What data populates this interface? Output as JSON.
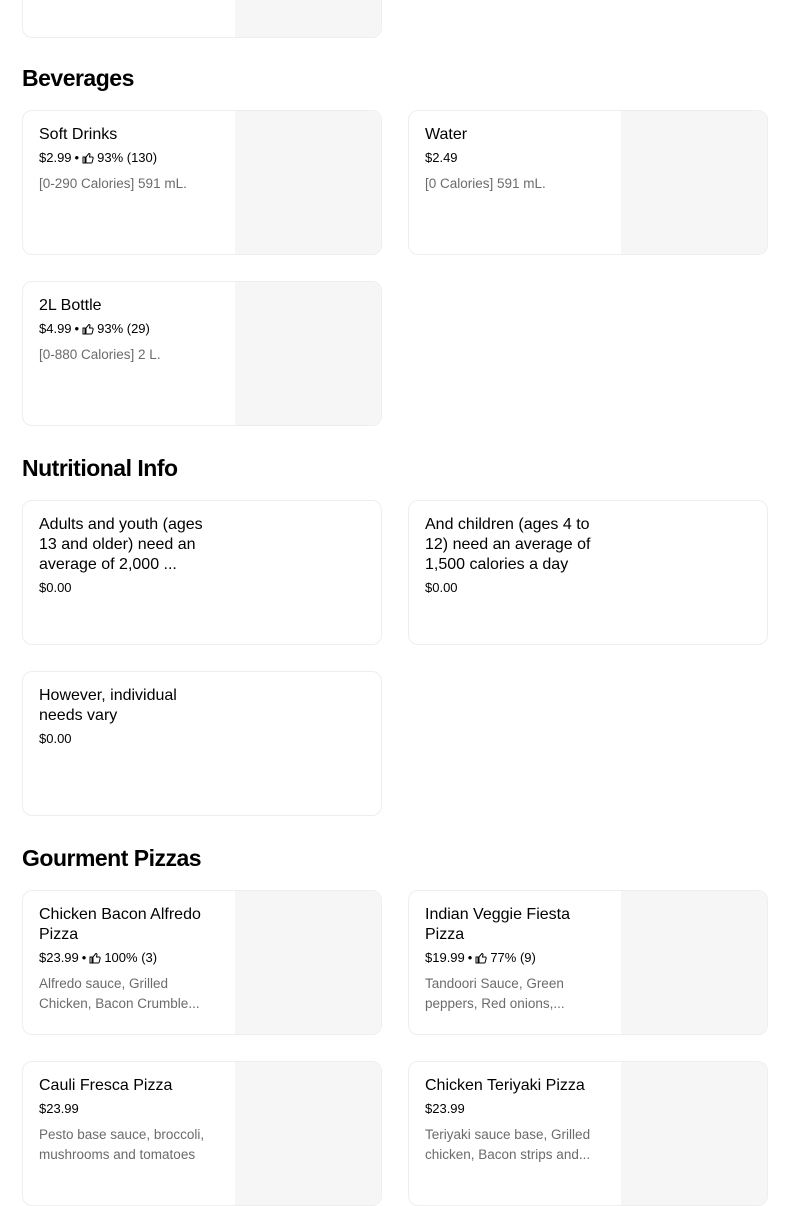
{
  "sections": {
    "beverages": {
      "title": "Beverages",
      "items": [
        {
          "name": "Soft Drinks",
          "price": "$2.99",
          "rating": "93% (130)",
          "description": "[0-290 Calories] 591 mL."
        },
        {
          "name": "Water",
          "price": "$2.49",
          "description": "[0 Calories] 591 mL."
        },
        {
          "name": "2L Bottle",
          "price": "$4.99",
          "rating": "93% (29)",
          "description": "[0-880 Calories] 2 L."
        }
      ]
    },
    "nutritional": {
      "title": "Nutritional Info",
      "items": [
        {
          "name": "Adults and youth (ages 13 and older) need an average of 2,000 ...",
          "price": "$0.00"
        },
        {
          "name": "And children (ages 4 to 12) need an average of 1,500 calories a day",
          "price": "$0.00"
        },
        {
          "name": "However, individual needs vary",
          "price": "$0.00"
        }
      ]
    },
    "gourmet": {
      "title": "Gourment Pizzas",
      "items": [
        {
          "name": "Chicken Bacon Alfredo Pizza",
          "price": "$23.99",
          "rating": "100% (3)",
          "description": "Alfredo sauce, Grilled Chicken, Bacon Crumble..."
        },
        {
          "name": "Indian Veggie Fiesta Pizza",
          "price": "$19.99",
          "rating": "77% (9)",
          "description": "Tandoori Sauce, Green peppers, Red onions,..."
        },
        {
          "name": "Cauli Fresca Pizza",
          "price": "$23.99",
          "description": "Pesto base sauce, broccoli, mushrooms and tomatoes"
        },
        {
          "name": "Chicken Teriyaki Pizza",
          "price": "$23.99",
          "description": "Teriyaki sauce base, Grilled chicken, Bacon strips and..."
        }
      ]
    }
  },
  "separator": "•",
  "icons": {
    "rating": "thumbs-up-icon"
  }
}
